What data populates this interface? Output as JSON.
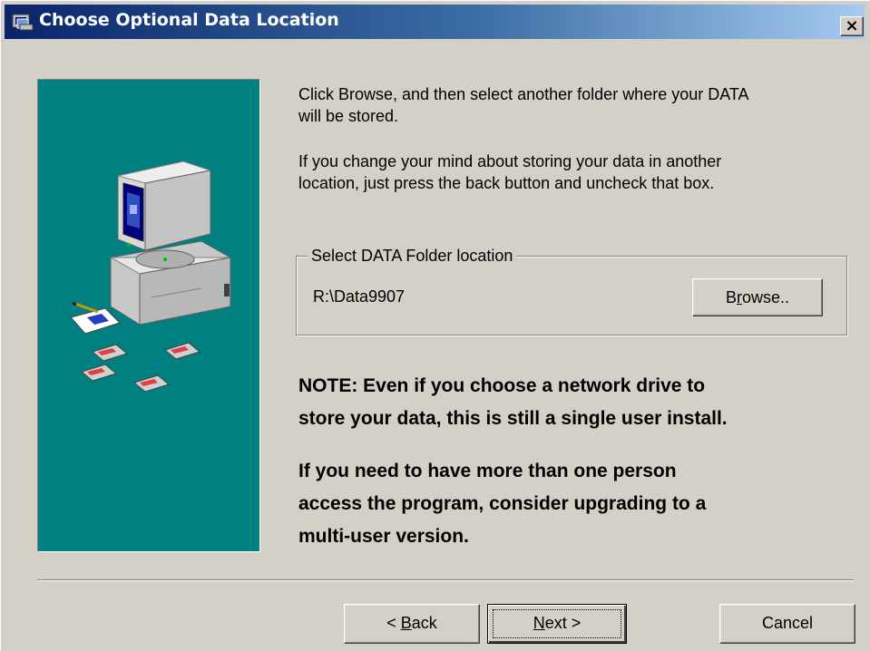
{
  "window": {
    "title": "Choose Optional Data Location",
    "close_symbol": "×",
    "icon": "setup-icon"
  },
  "art": {
    "icon": "computer-with-disks-illustration"
  },
  "instructions": {
    "line1": "Click Browse, and then select another folder where your DATA",
    "line2": "will be stored.",
    "line3": "If you change your mind about storing your data in another",
    "line4": "location, just press the back button and uncheck that box."
  },
  "data_folder": {
    "group_label": "Select DATA Folder location",
    "path": "R:\\Data9907",
    "browse_pre": "B",
    "browse_accel": "r",
    "browse_post": "owse.."
  },
  "note": {
    "line1": "NOTE: Even if you choose a network drive to",
    "line2": "store your data, this is still a single user install.",
    "line3": "If you need to have more than one person",
    "line4": "access the program, consider upgrading to a",
    "line5": "multi-user version."
  },
  "buttons": {
    "back_pre": "< ",
    "back_accel": "B",
    "back_post": "ack",
    "next_accel": "N",
    "next_post": "ext >",
    "cancel": "Cancel"
  },
  "colors": {
    "dialog_bg": "#d4d0c8",
    "art_bg": "#008080",
    "title_start": "#0a246a",
    "title_end": "#a6caf0"
  }
}
